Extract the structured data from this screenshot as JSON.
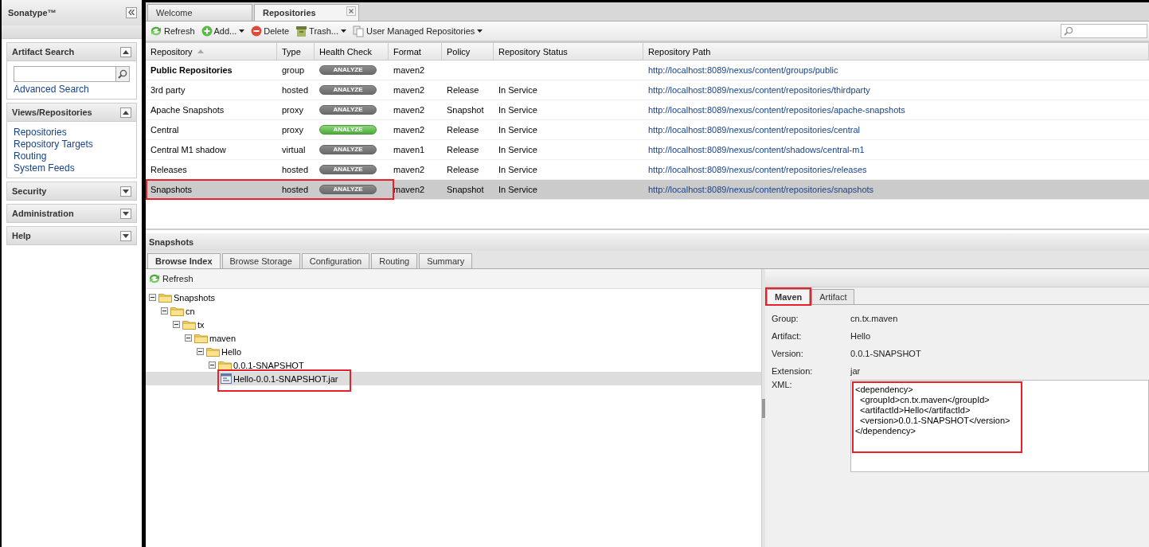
{
  "sidebar": {
    "title": "Sonatype™",
    "sections": [
      {
        "title": "Artifact Search",
        "expanded": true,
        "search": true,
        "links": [
          "Advanced Search"
        ]
      },
      {
        "title": "Views/Repositories",
        "expanded": true,
        "links": [
          "Repositories",
          "Repository Targets",
          "Routing",
          "System Feeds"
        ]
      },
      {
        "title": "Security",
        "expanded": false
      },
      {
        "title": "Administration",
        "expanded": false
      },
      {
        "title": "Help",
        "expanded": false
      }
    ]
  },
  "tabs": [
    {
      "label": "Welcome",
      "selected": false,
      "closable": false
    },
    {
      "label": "Repositories",
      "selected": true,
      "closable": true
    }
  ],
  "toolbar": [
    {
      "kind": "refresh",
      "label": "Refresh",
      "menu": false
    },
    {
      "kind": "add",
      "label": "Add...",
      "menu": true
    },
    {
      "kind": "delete",
      "label": "Delete",
      "menu": false
    },
    {
      "kind": "trash",
      "label": "Trash...",
      "menu": true
    },
    {
      "kind": "pages",
      "label": "User Managed Repositories",
      "menu": true
    }
  ],
  "table": {
    "columns": [
      "Repository",
      "Type",
      "Health Check",
      "Format",
      "Policy",
      "Repository Status",
      "Repository Path"
    ],
    "rows": [
      {
        "kind": "group",
        "name": "Public Repositories",
        "type": "group",
        "analyze": "ANALYZE",
        "active": false,
        "format": "maven2",
        "path": "http://localhost:8089/nexus/content/groups/public",
        "selected": false,
        "annotated": false
      },
      {
        "kind": "repository",
        "name": "3rd party",
        "type": "hosted",
        "analyze": "ANALYZE",
        "active": false,
        "format": "maven2",
        "policy": "Release",
        "status": "In Service",
        "path": "http://localhost:8089/nexus/content/repositories/thirdparty",
        "selected": false,
        "annotated": false
      },
      {
        "kind": "repository",
        "name": "Apache Snapshots",
        "type": "proxy",
        "analyze": "ANALYZE",
        "active": false,
        "format": "maven2",
        "policy": "Snapshot",
        "status": "In Service",
        "path": "http://localhost:8089/nexus/content/repositories/apache-snapshots",
        "selected": false,
        "annotated": false
      },
      {
        "kind": "repository",
        "name": "Central",
        "type": "proxy",
        "analyze": "ANALYZE",
        "active": true,
        "format": "maven2",
        "policy": "Release",
        "status": "In Service",
        "path": "http://localhost:8089/nexus/content/repositories/central",
        "selected": false,
        "annotated": false
      },
      {
        "kind": "repository",
        "name": "Central M1 shadow",
        "type": "virtual",
        "analyze": "ANALYZE",
        "active": false,
        "format": "maven1",
        "policy": "Release",
        "status": "In Service",
        "path": "http://localhost:8089/nexus/content/shadows/central-m1",
        "selected": false,
        "annotated": false
      },
      {
        "kind": "repository",
        "name": "Releases",
        "type": "hosted",
        "analyze": "ANALYZE",
        "active": false,
        "format": "maven2",
        "policy": "Release",
        "status": "In Service",
        "path": "http://localhost:8089/nexus/content/repositories/releases",
        "selected": false,
        "annotated": false
      },
      {
        "kind": "repository",
        "name": "Snapshots",
        "type": "hosted",
        "analyze": "ANALYZE",
        "active": false,
        "format": "maven2",
        "policy": "Snapshot",
        "status": "In Service",
        "path": "http://localhost:8089/nexus/content/repositories/snapshots",
        "selected": true,
        "annotated": true
      }
    ]
  },
  "detail": {
    "title": "Snapshots",
    "tabs": [
      {
        "label": "Browse Index",
        "selected": true
      },
      {
        "label": "Browse Storage",
        "selected": false
      },
      {
        "label": "Configuration",
        "selected": false
      },
      {
        "label": "Routing",
        "selected": false
      },
      {
        "label": "Summary",
        "selected": false
      }
    ],
    "refresh": "Refresh",
    "tree": [
      {
        "kind": "folder",
        "label": "Snapshots",
        "expanded": true,
        "selected": false,
        "children": [
          {
            "kind": "folder",
            "label": "cn",
            "expanded": true,
            "selected": false,
            "children": [
              {
                "kind": "folder",
                "label": "tx",
                "expanded": true,
                "selected": false,
                "children": [
                  {
                    "kind": "folder",
                    "label": "maven",
                    "expanded": true,
                    "selected": false,
                    "children": [
                      {
                        "kind": "folder",
                        "label": "Hello",
                        "expanded": true,
                        "selected": false,
                        "children": [
                          {
                            "kind": "folder",
                            "label": "0.0.1-SNAPSHOT",
                            "expanded": true,
                            "selected": false,
                            "children": [
                              {
                                "kind": "file",
                                "label": "Hello-0.0.1-SNAPSHOT.jar",
                                "selected": true,
                                "annotated": true
                              }
                            ]
                          }
                        ]
                      }
                    ]
                  }
                ]
              }
            ]
          }
        ]
      }
    ],
    "info_tabs": [
      {
        "label": "Maven",
        "selected": true,
        "annotated": true
      },
      {
        "label": "Artifact",
        "selected": false,
        "annotated": false
      }
    ],
    "fields": [
      {
        "label": "Group:",
        "value": "cn.tx.maven"
      },
      {
        "label": "Artifact:",
        "value": "Hello"
      },
      {
        "label": "Version:",
        "value": "0.0.1-SNAPSHOT"
      },
      {
        "label": "Extension:",
        "value": "jar"
      }
    ],
    "xml": {
      "label": "XML:",
      "lines": [
        "<dependency>",
        "  <groupId>cn.tx.maven</groupId>",
        "  <artifactId>Hello</artifactId>",
        "  <version>0.0.1-SNAPSHOT</version>",
        "</dependency>"
      ],
      "annotated": true
    }
  }
}
